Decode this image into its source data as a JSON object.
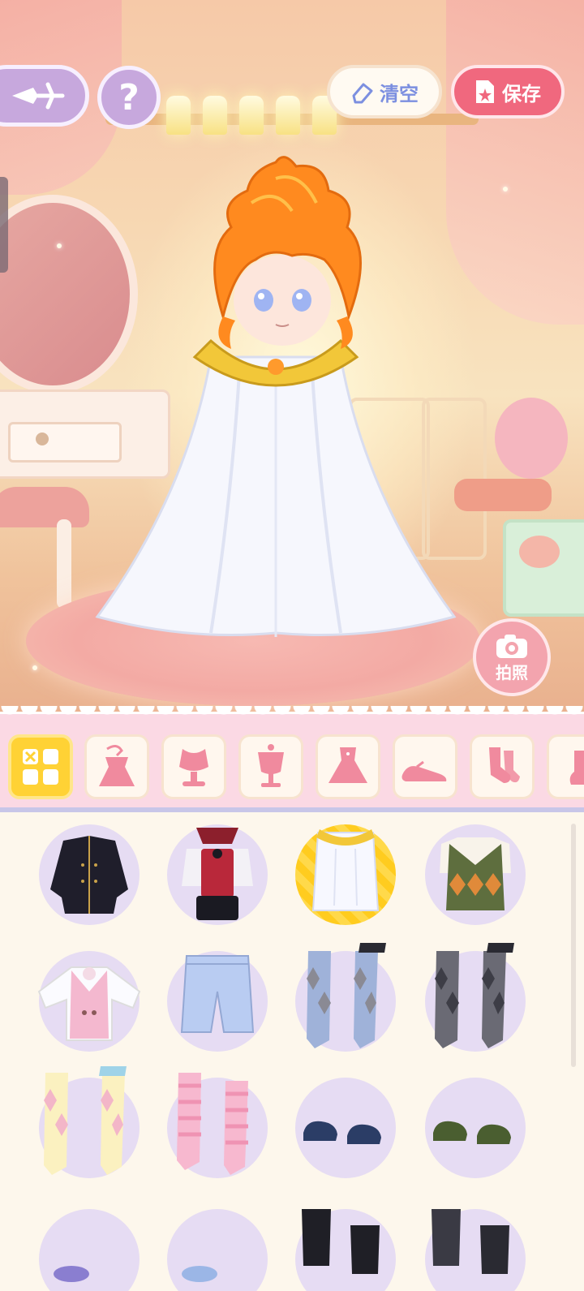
{
  "top_bar": {
    "clear_label": "清空",
    "save_label": "保存"
  },
  "help_glyph": "?",
  "photo_label": "拍照",
  "categories": [
    {
      "id": "all",
      "icon": "grid-icon",
      "active": true
    },
    {
      "id": "outfit",
      "icon": "dress-hanger-icon",
      "active": false
    },
    {
      "id": "top",
      "icon": "bust-top-icon",
      "active": false
    },
    {
      "id": "vest",
      "icon": "mannequin-icon",
      "active": false
    },
    {
      "id": "dress",
      "icon": "dress-icon",
      "active": false
    },
    {
      "id": "shoes",
      "icon": "flat-shoe-icon",
      "active": false
    },
    {
      "id": "socks",
      "icon": "socks-icon",
      "active": false
    },
    {
      "id": "more",
      "icon": "boot-icon",
      "active": false
    }
  ],
  "items": [
    {
      "name": "black-coat",
      "selected": false
    },
    {
      "name": "vampire-outfit",
      "selected": false
    },
    {
      "name": "white-top",
      "selected": true
    },
    {
      "name": "argyle-vest",
      "selected": false
    },
    {
      "name": "pink-vest-blouse",
      "selected": false
    },
    {
      "name": "blue-shorts",
      "selected": false
    },
    {
      "name": "blue-argyle-socks",
      "selected": false
    },
    {
      "name": "gray-argyle-socks",
      "selected": false
    },
    {
      "name": "yellow-argyle-socks",
      "selected": false
    },
    {
      "name": "pink-striped-socks",
      "selected": false
    },
    {
      "name": "navy-shoes",
      "selected": false
    },
    {
      "name": "green-shoes",
      "selected": false
    },
    {
      "name": "purple-item",
      "selected": false
    },
    {
      "name": "blue-item",
      "selected": false
    },
    {
      "name": "black-boots",
      "selected": false
    },
    {
      "name": "gray-boots",
      "selected": false
    }
  ],
  "colors": {
    "accent_pink": "#f0687e",
    "accent_purple": "#c7a8dd",
    "active_yellow": "#ffd235",
    "clear_blue": "#7c8fe0"
  }
}
